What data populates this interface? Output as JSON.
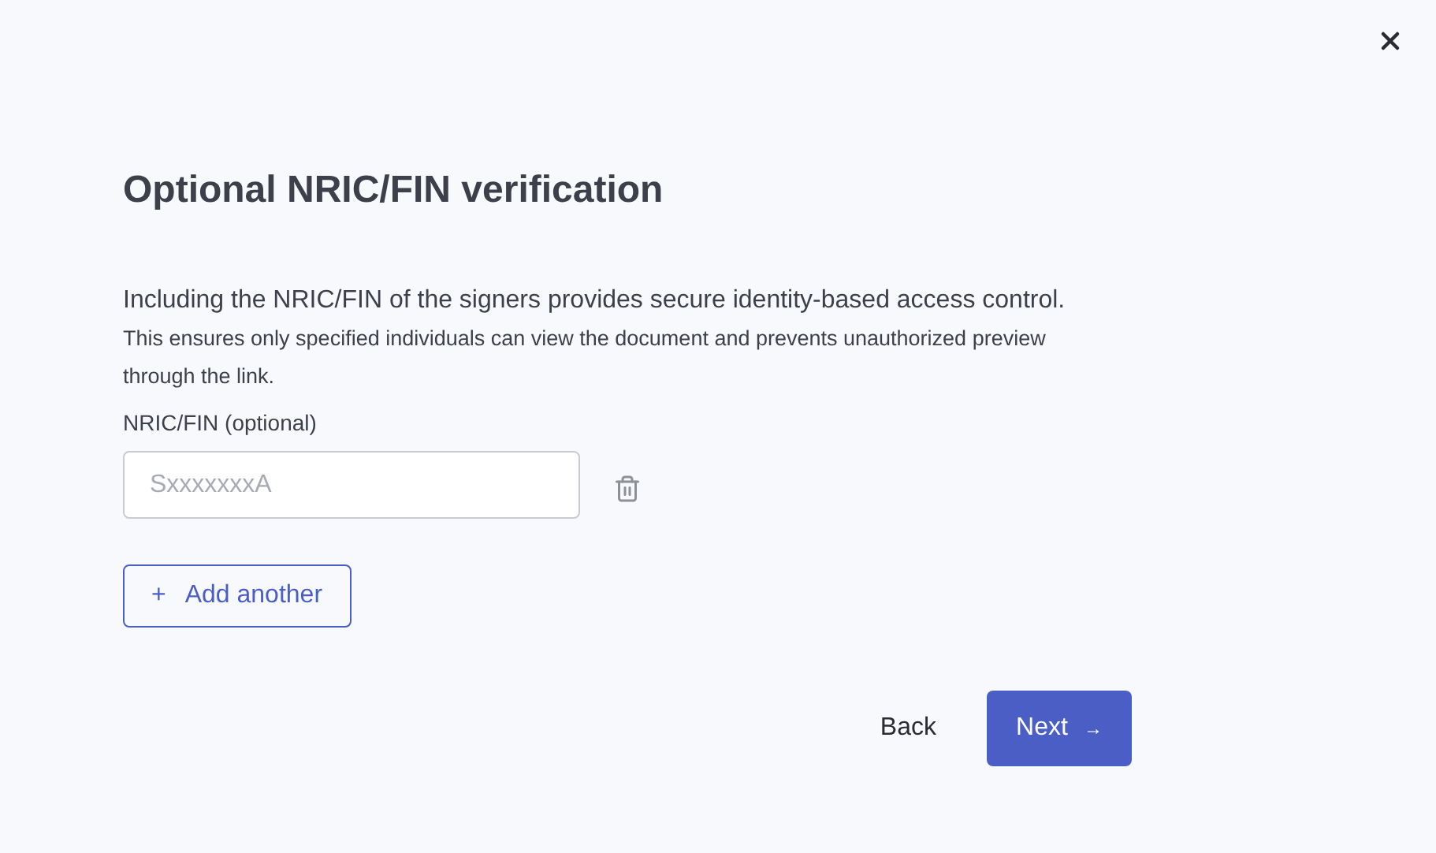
{
  "title": "Optional NRIC/FIN verification",
  "description": "Including the NRIC/FIN of the signers provides secure identity-based access control.",
  "note": "This ensures only specified individuals can view the document and prevents unauthorized preview through the link.",
  "fields": [
    {
      "label": "NRIC/FIN (optional)",
      "placeholder": "SxxxxxxxA"
    }
  ],
  "add_button": {
    "icon": "+",
    "label": "Add another"
  },
  "back_button": "Back",
  "next_button": {
    "label": "Next",
    "icon": "→"
  }
}
